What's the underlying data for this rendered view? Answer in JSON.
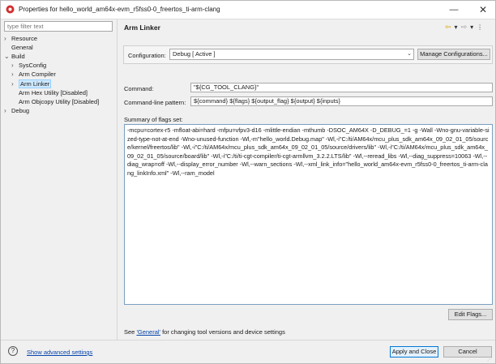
{
  "window": {
    "title": "Properties for hello_world_am64x-evm_r5fss0-0_freertos_ti-arm-clang"
  },
  "filter": {
    "placeholder": "type filter text"
  },
  "tree": [
    {
      "label": "Resource",
      "chevron": "›",
      "indent": 0
    },
    {
      "label": "General",
      "chevron": "",
      "indent": 0
    },
    {
      "label": "Build",
      "chevron": "⌄",
      "indent": 0
    },
    {
      "label": "SysConfig",
      "chevron": "›",
      "indent": 1
    },
    {
      "label": "Arm Compiler",
      "chevron": "›",
      "indent": 1
    },
    {
      "label": "Arm Linker",
      "chevron": "›",
      "indent": 1,
      "selected": true
    },
    {
      "label": "Arm Hex Utility  [Disabled]",
      "chevron": "",
      "indent": 1
    },
    {
      "label": "Arm Objcopy Utility  [Disabled]",
      "chevron": "",
      "indent": 1
    },
    {
      "label": "Debug",
      "chevron": "›",
      "indent": 0
    }
  ],
  "page": {
    "title": "Arm Linker"
  },
  "nav": {
    "back": "⇦",
    "forward": "⇨",
    "menu": "⋮"
  },
  "configuration": {
    "label": "Configuration:",
    "selected": "Debug  [ Active ]",
    "manage_button": "Manage Configurations..."
  },
  "command": {
    "label": "Command:",
    "value": "\"${CG_TOOL_CLANG}\""
  },
  "pattern": {
    "label": "Command-line pattern:",
    "value": "${command} ${flags} ${output_flag} ${output} ${inputs}"
  },
  "summary": {
    "label": "Summary of flags set:",
    "text": "-mcpu=cortex-r5 -mfloat-abi=hard -mfpu=vfpv3-d16 -mlittle-endian -mthumb -DSOC_AM64X -D_DEBUG_=1 -g -Wall -Wno-gnu-variable-sized-type-not-at-end -Wno-unused-function -Wl,-m\"hello_world.Debug.map\" -Wl,-i\"C:/ti/AM64x/mcu_plus_sdk_am64x_09_02_01_05/source/kernel/freertos/lib\" -Wl,-i\"C:/ti/AM64x/mcu_plus_sdk_am64x_09_02_01_05/source/drivers/lib\" -Wl,-i\"C:/ti/AM64x/mcu_plus_sdk_am64x_09_02_01_05/source/board/lib\" -Wl,-i\"C:/ti/ti-cgt-compiler/ti-cgt-armllvm_3.2.2.LTS/lib\" -Wl,--reread_libs -Wl,--diag_suppress=10063 -Wl,--diag_wrap=off -Wl,--display_error_number -Wl,--warn_sections -Wl,--xml_link_info=\"hello_world_am64x-evm_r5fss0-0_freertos_ti-arm-clang_linkInfo.xml\" -Wl,--ram_model"
  },
  "edit_flags_button": "Edit Flags...",
  "see_general": {
    "prefix": "See ",
    "link": "'General'",
    "suffix": " for changing tool versions and device settings"
  },
  "footer": {
    "help": "?",
    "advanced_link": "Show advanced settings",
    "apply_close": "Apply and Close",
    "cancel": "Cancel"
  }
}
